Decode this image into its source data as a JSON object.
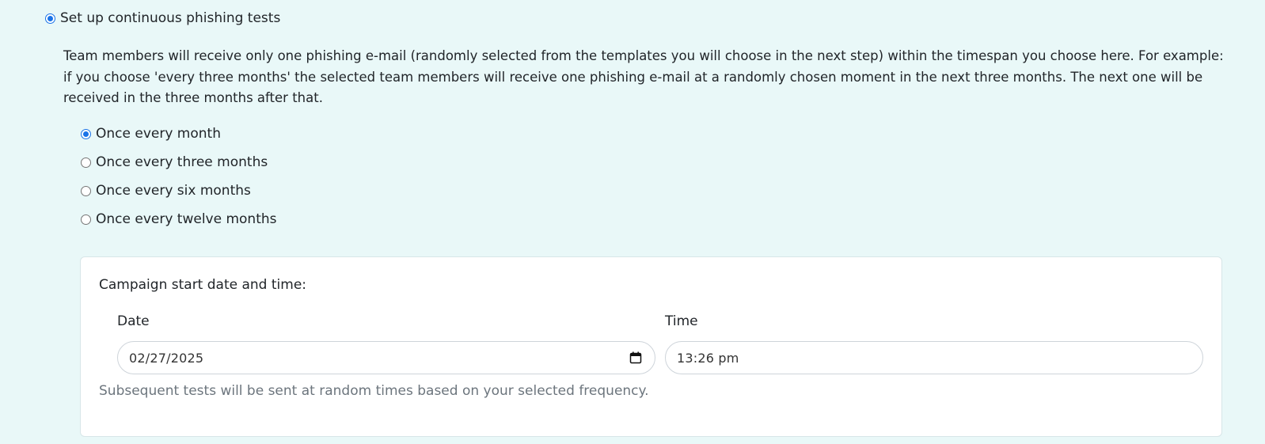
{
  "main_option": {
    "label": "Set up continuous phishing tests",
    "checked": true
  },
  "description": "Team members will receive only one phishing e-mail (randomly selected from the templates you will choose in the next step) within the timespan you choose here. For example: if you choose 'every three months' the selected team members will receive one phishing e-mail at a randomly chosen moment in the next three months. The next one will be received in the three months after that.",
  "frequency_options": [
    {
      "label": "Once every month",
      "checked": true
    },
    {
      "label": "Once every three months",
      "checked": false
    },
    {
      "label": "Once every six months",
      "checked": false
    },
    {
      "label": "Once every twelve months",
      "checked": false
    }
  ],
  "campaign": {
    "title": "Campaign start date and time:",
    "date_label": "Date",
    "date_value": "02/27/2025",
    "time_label": "Time",
    "time_value": "13:26 pm",
    "help_text": "Subsequent tests will be sent at random times based on your selected frequency."
  },
  "colors": {
    "background": "#e9f8f8",
    "accent": "#1a73e8",
    "card_background": "#ffffff",
    "muted_text": "#6c757d"
  }
}
